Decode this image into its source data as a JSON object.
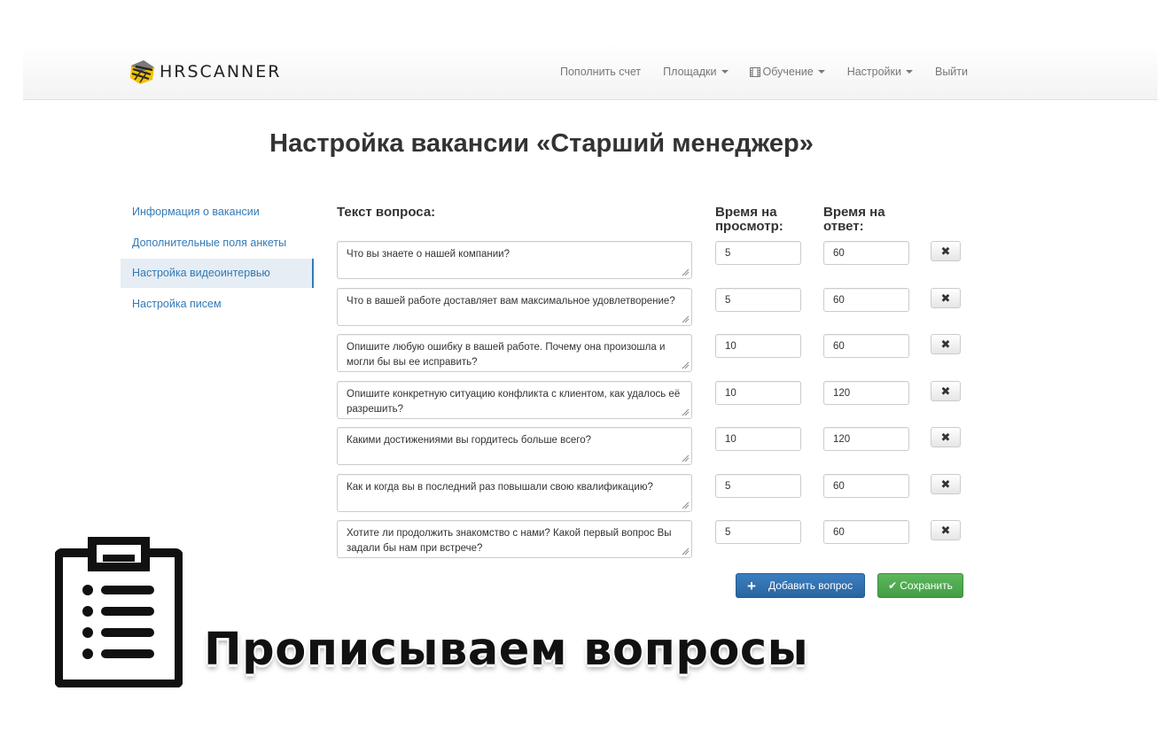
{
  "header": {
    "logo_text": "HRSCANNER",
    "nav": [
      {
        "label": "Пополнить счет",
        "dropdown": false,
        "icon": ""
      },
      {
        "label": "Площадки",
        "dropdown": true,
        "icon": ""
      },
      {
        "label": "Обучение",
        "dropdown": true,
        "icon": "film-icon"
      },
      {
        "label": "Настройки",
        "dropdown": true,
        "icon": ""
      },
      {
        "label": "Выйти",
        "dropdown": false,
        "icon": ""
      }
    ]
  },
  "page_title": "Настройка вакансии «Старший менеджер»",
  "sidebar": {
    "items": [
      {
        "label": "Информация о вакансии",
        "active": false
      },
      {
        "label": "Дополнительные поля анкеты",
        "active": false
      },
      {
        "label": "Настройка видеоинтервью",
        "active": true
      },
      {
        "label": "Настройка писем",
        "active": false
      }
    ]
  },
  "columns": {
    "question": "Текст вопроса:",
    "view_time_1": "Время на",
    "view_time_2": "просмотр:",
    "answer_time_1": "Время на",
    "answer_time_2": "ответ:"
  },
  "questions": [
    {
      "text": "Что вы знаете о нашей компании?",
      "view": "5",
      "answer": "60"
    },
    {
      "text": "Что в вашей работе доставляет вам максимальное удовлетворение?",
      "view": "5",
      "answer": "60"
    },
    {
      "text": "Опишите любую ошибку в вашей работе. Почему она произошла и могли бы вы ее исправить?",
      "view": "10",
      "answer": "60"
    },
    {
      "text": "Опишите конкретную ситуацию конфликта с клиентом, как удалось её разрешить?",
      "view": "10",
      "answer": "120"
    },
    {
      "text": "Какими достижениями вы гордитесь больше всего?",
      "view": "10",
      "answer": "120"
    },
    {
      "text": "Как и когда вы в последний раз повышали свою квалификацию?",
      "view": "5",
      "answer": "60"
    },
    {
      "text": "Хотите ли продолжить знакомство с нами? Какой первый вопрос Вы задали бы нам при встрече?",
      "view": "5",
      "answer": "60"
    }
  ],
  "delete_glyph": "✖",
  "buttons": {
    "add_icon": "+",
    "add_label": "Добавить вопрос",
    "save_icon": "✔",
    "save_label": "Сохранить"
  },
  "overlay": {
    "caption": "Прописываем вопросы",
    "icon": "clipboard-list-icon"
  },
  "colors": {
    "link": "#337ab7",
    "primary": "#2f6fae",
    "success": "#4cae4c"
  }
}
